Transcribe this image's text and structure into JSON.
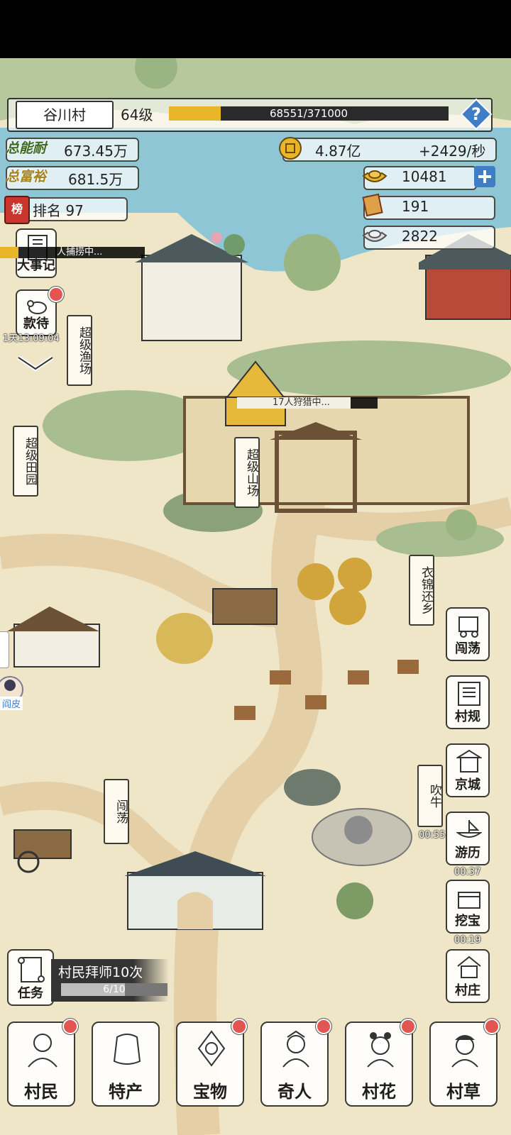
{
  "header": {
    "village_name": "谷川村",
    "level": "64级",
    "xp_text": "68551/371000",
    "xp_progress": 0.1848,
    "help_icon": "question-icon"
  },
  "stats": {
    "total_power_label": "总能耐",
    "total_power": "673.45万",
    "total_wealth_label": "总富裕",
    "total_wealth": "681.5万",
    "rank_badge": "榜",
    "rank": "排名 97"
  },
  "resources": {
    "coins": "4.87亿",
    "coins_rate": "+2429/秒",
    "gold_ingot": "10481",
    "tokens": "191",
    "silver": "2822"
  },
  "left_buttons": {
    "events": "大事记",
    "reception": "款待",
    "reception_timer": "1天13:09:04",
    "avatar_name": "阎皮"
  },
  "map_labels": {
    "fishing": "超级渔场",
    "fishing_progress": "人捕捞中...",
    "farm": "超级田园",
    "mountain": "超级山场",
    "mountain_progress": "17人狩猎中...",
    "return_home": "衣锦还乡",
    "wander": "闯荡",
    "brag": "吹牛"
  },
  "right_buttons": {
    "wander": "闯荡",
    "rules": "村规",
    "capital": "京城",
    "travel": "游历",
    "travel_timer": "00:37",
    "treasure": "挖宝",
    "treasure_timer": "00:19",
    "brag_timer": "00:55",
    "village": "村庄"
  },
  "quest": {
    "label": "任务",
    "title": "村民拜师10次",
    "progress_text": "6/10",
    "progress": 0.6
  },
  "tabs": {
    "villagers": "村民",
    "specialty": "特产",
    "treasure": "宝物",
    "oddities": "奇人",
    "belle": "村花",
    "grass": "村草"
  },
  "colors": {
    "water": "#8fc6d6",
    "ground": "#efe6c8",
    "path": "#e4cfa6",
    "hill": "#a8bd90",
    "xp_fill": "#e8b628",
    "badge_red": "#e25550",
    "gold": "#e8b628"
  }
}
